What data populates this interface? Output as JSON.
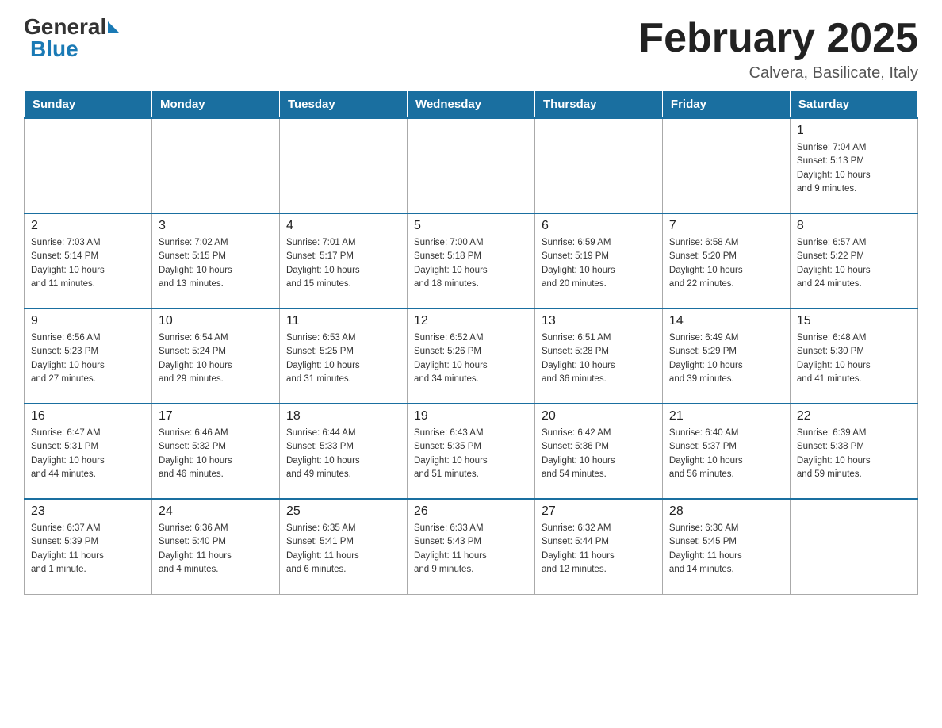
{
  "header": {
    "logo_general": "General",
    "logo_blue": "Blue",
    "month_title": "February 2025",
    "location": "Calvera, Basilicate, Italy"
  },
  "weekdays": [
    "Sunday",
    "Monday",
    "Tuesday",
    "Wednesday",
    "Thursday",
    "Friday",
    "Saturday"
  ],
  "weeks": [
    {
      "days": [
        {
          "num": "",
          "info": "",
          "empty": true
        },
        {
          "num": "",
          "info": "",
          "empty": true
        },
        {
          "num": "",
          "info": "",
          "empty": true
        },
        {
          "num": "",
          "info": "",
          "empty": true
        },
        {
          "num": "",
          "info": "",
          "empty": true
        },
        {
          "num": "",
          "info": "",
          "empty": true
        },
        {
          "num": "1",
          "info": "Sunrise: 7:04 AM\nSunset: 5:13 PM\nDaylight: 10 hours\nand 9 minutes.",
          "empty": false
        }
      ]
    },
    {
      "days": [
        {
          "num": "2",
          "info": "Sunrise: 7:03 AM\nSunset: 5:14 PM\nDaylight: 10 hours\nand 11 minutes.",
          "empty": false
        },
        {
          "num": "3",
          "info": "Sunrise: 7:02 AM\nSunset: 5:15 PM\nDaylight: 10 hours\nand 13 minutes.",
          "empty": false
        },
        {
          "num": "4",
          "info": "Sunrise: 7:01 AM\nSunset: 5:17 PM\nDaylight: 10 hours\nand 15 minutes.",
          "empty": false
        },
        {
          "num": "5",
          "info": "Sunrise: 7:00 AM\nSunset: 5:18 PM\nDaylight: 10 hours\nand 18 minutes.",
          "empty": false
        },
        {
          "num": "6",
          "info": "Sunrise: 6:59 AM\nSunset: 5:19 PM\nDaylight: 10 hours\nand 20 minutes.",
          "empty": false
        },
        {
          "num": "7",
          "info": "Sunrise: 6:58 AM\nSunset: 5:20 PM\nDaylight: 10 hours\nand 22 minutes.",
          "empty": false
        },
        {
          "num": "8",
          "info": "Sunrise: 6:57 AM\nSunset: 5:22 PM\nDaylight: 10 hours\nand 24 minutes.",
          "empty": false
        }
      ]
    },
    {
      "days": [
        {
          "num": "9",
          "info": "Sunrise: 6:56 AM\nSunset: 5:23 PM\nDaylight: 10 hours\nand 27 minutes.",
          "empty": false
        },
        {
          "num": "10",
          "info": "Sunrise: 6:54 AM\nSunset: 5:24 PM\nDaylight: 10 hours\nand 29 minutes.",
          "empty": false
        },
        {
          "num": "11",
          "info": "Sunrise: 6:53 AM\nSunset: 5:25 PM\nDaylight: 10 hours\nand 31 minutes.",
          "empty": false
        },
        {
          "num": "12",
          "info": "Sunrise: 6:52 AM\nSunset: 5:26 PM\nDaylight: 10 hours\nand 34 minutes.",
          "empty": false
        },
        {
          "num": "13",
          "info": "Sunrise: 6:51 AM\nSunset: 5:28 PM\nDaylight: 10 hours\nand 36 minutes.",
          "empty": false
        },
        {
          "num": "14",
          "info": "Sunrise: 6:49 AM\nSunset: 5:29 PM\nDaylight: 10 hours\nand 39 minutes.",
          "empty": false
        },
        {
          "num": "15",
          "info": "Sunrise: 6:48 AM\nSunset: 5:30 PM\nDaylight: 10 hours\nand 41 minutes.",
          "empty": false
        }
      ]
    },
    {
      "days": [
        {
          "num": "16",
          "info": "Sunrise: 6:47 AM\nSunset: 5:31 PM\nDaylight: 10 hours\nand 44 minutes.",
          "empty": false
        },
        {
          "num": "17",
          "info": "Sunrise: 6:46 AM\nSunset: 5:32 PM\nDaylight: 10 hours\nand 46 minutes.",
          "empty": false
        },
        {
          "num": "18",
          "info": "Sunrise: 6:44 AM\nSunset: 5:33 PM\nDaylight: 10 hours\nand 49 minutes.",
          "empty": false
        },
        {
          "num": "19",
          "info": "Sunrise: 6:43 AM\nSunset: 5:35 PM\nDaylight: 10 hours\nand 51 minutes.",
          "empty": false
        },
        {
          "num": "20",
          "info": "Sunrise: 6:42 AM\nSunset: 5:36 PM\nDaylight: 10 hours\nand 54 minutes.",
          "empty": false
        },
        {
          "num": "21",
          "info": "Sunrise: 6:40 AM\nSunset: 5:37 PM\nDaylight: 10 hours\nand 56 minutes.",
          "empty": false
        },
        {
          "num": "22",
          "info": "Sunrise: 6:39 AM\nSunset: 5:38 PM\nDaylight: 10 hours\nand 59 minutes.",
          "empty": false
        }
      ]
    },
    {
      "days": [
        {
          "num": "23",
          "info": "Sunrise: 6:37 AM\nSunset: 5:39 PM\nDaylight: 11 hours\nand 1 minute.",
          "empty": false
        },
        {
          "num": "24",
          "info": "Sunrise: 6:36 AM\nSunset: 5:40 PM\nDaylight: 11 hours\nand 4 minutes.",
          "empty": false
        },
        {
          "num": "25",
          "info": "Sunrise: 6:35 AM\nSunset: 5:41 PM\nDaylight: 11 hours\nand 6 minutes.",
          "empty": false
        },
        {
          "num": "26",
          "info": "Sunrise: 6:33 AM\nSunset: 5:43 PM\nDaylight: 11 hours\nand 9 minutes.",
          "empty": false
        },
        {
          "num": "27",
          "info": "Sunrise: 6:32 AM\nSunset: 5:44 PM\nDaylight: 11 hours\nand 12 minutes.",
          "empty": false
        },
        {
          "num": "28",
          "info": "Sunrise: 6:30 AM\nSunset: 5:45 PM\nDaylight: 11 hours\nand 14 minutes.",
          "empty": false
        },
        {
          "num": "",
          "info": "",
          "empty": true
        }
      ]
    }
  ]
}
